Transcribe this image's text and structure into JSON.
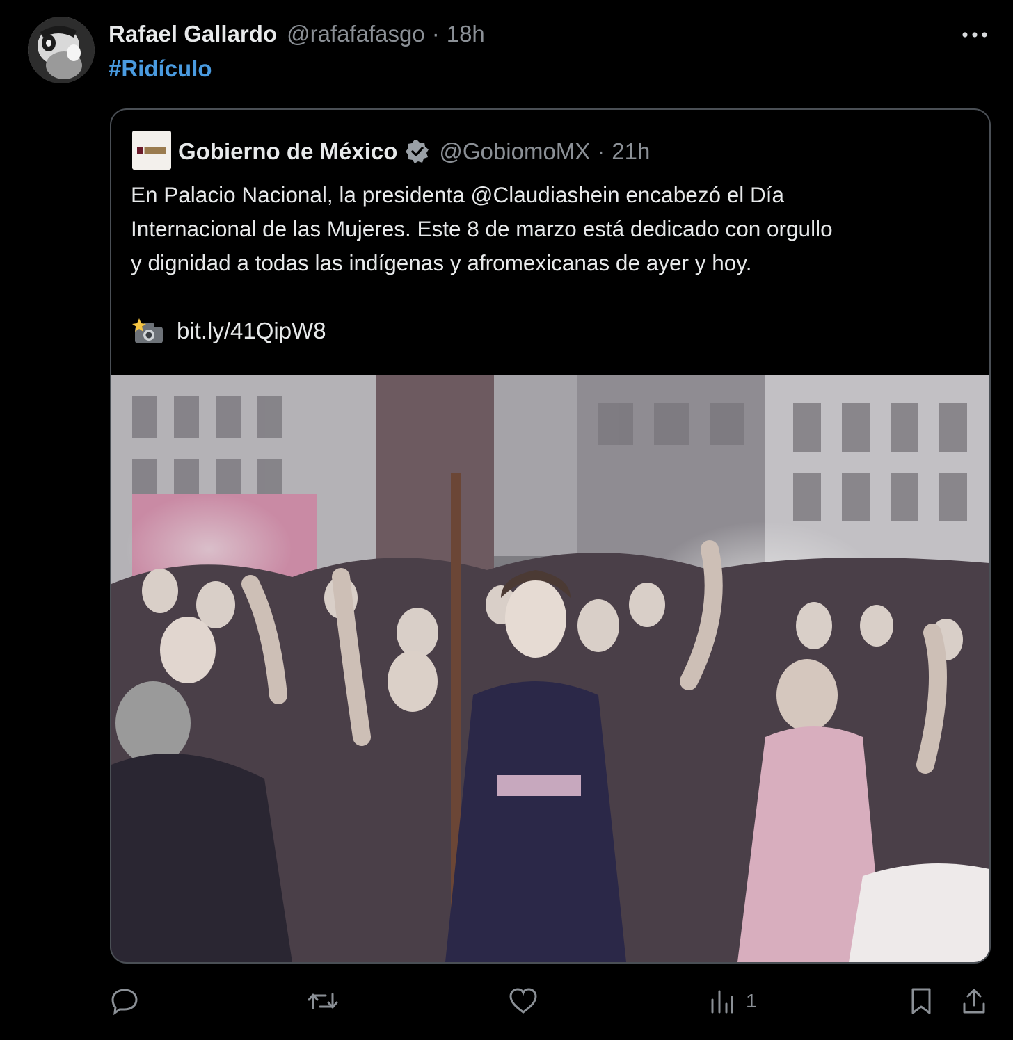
{
  "post": {
    "author": {
      "display_name": "Rafael Gallardo",
      "handle": "@rafafafasgo",
      "separator": "·",
      "time": "18h"
    },
    "text": "#Ridículo",
    "more_icon": "more-horizontal-icon",
    "quoted": {
      "author": {
        "display_name": "Gobierno de México",
        "verified_icon": "verified-badge-icon",
        "handle": "@GobiomoMX",
        "separator": "·",
        "time": "21h"
      },
      "text_lines": [
        "En Palacio Nacional, la presidenta @Claudiashein encabezó el Día",
        "Internacional de las Mujeres. Este 8 de marzo está dedicado con orgullo",
        "y dignidad a todas las indígenas y afromexicanas de ayer y hoy."
      ],
      "link_icon": "camera-flash-icon",
      "link_text": "bit.ly/41QipW8"
    },
    "actions": {
      "reply_icon": "reply-icon",
      "repost_icon": "repost-icon",
      "like_icon": "heart-icon",
      "views_icon": "views-chart-icon",
      "views_count": "1",
      "bookmark_icon": "bookmark-icon",
      "share_icon": "share-icon"
    }
  },
  "colors": {
    "background": "#000000",
    "text_primary": "#e7e9ea",
    "text_secondary": "#8b9096",
    "hashtag": "#4a9be0",
    "card_border": "#4a4f55"
  }
}
